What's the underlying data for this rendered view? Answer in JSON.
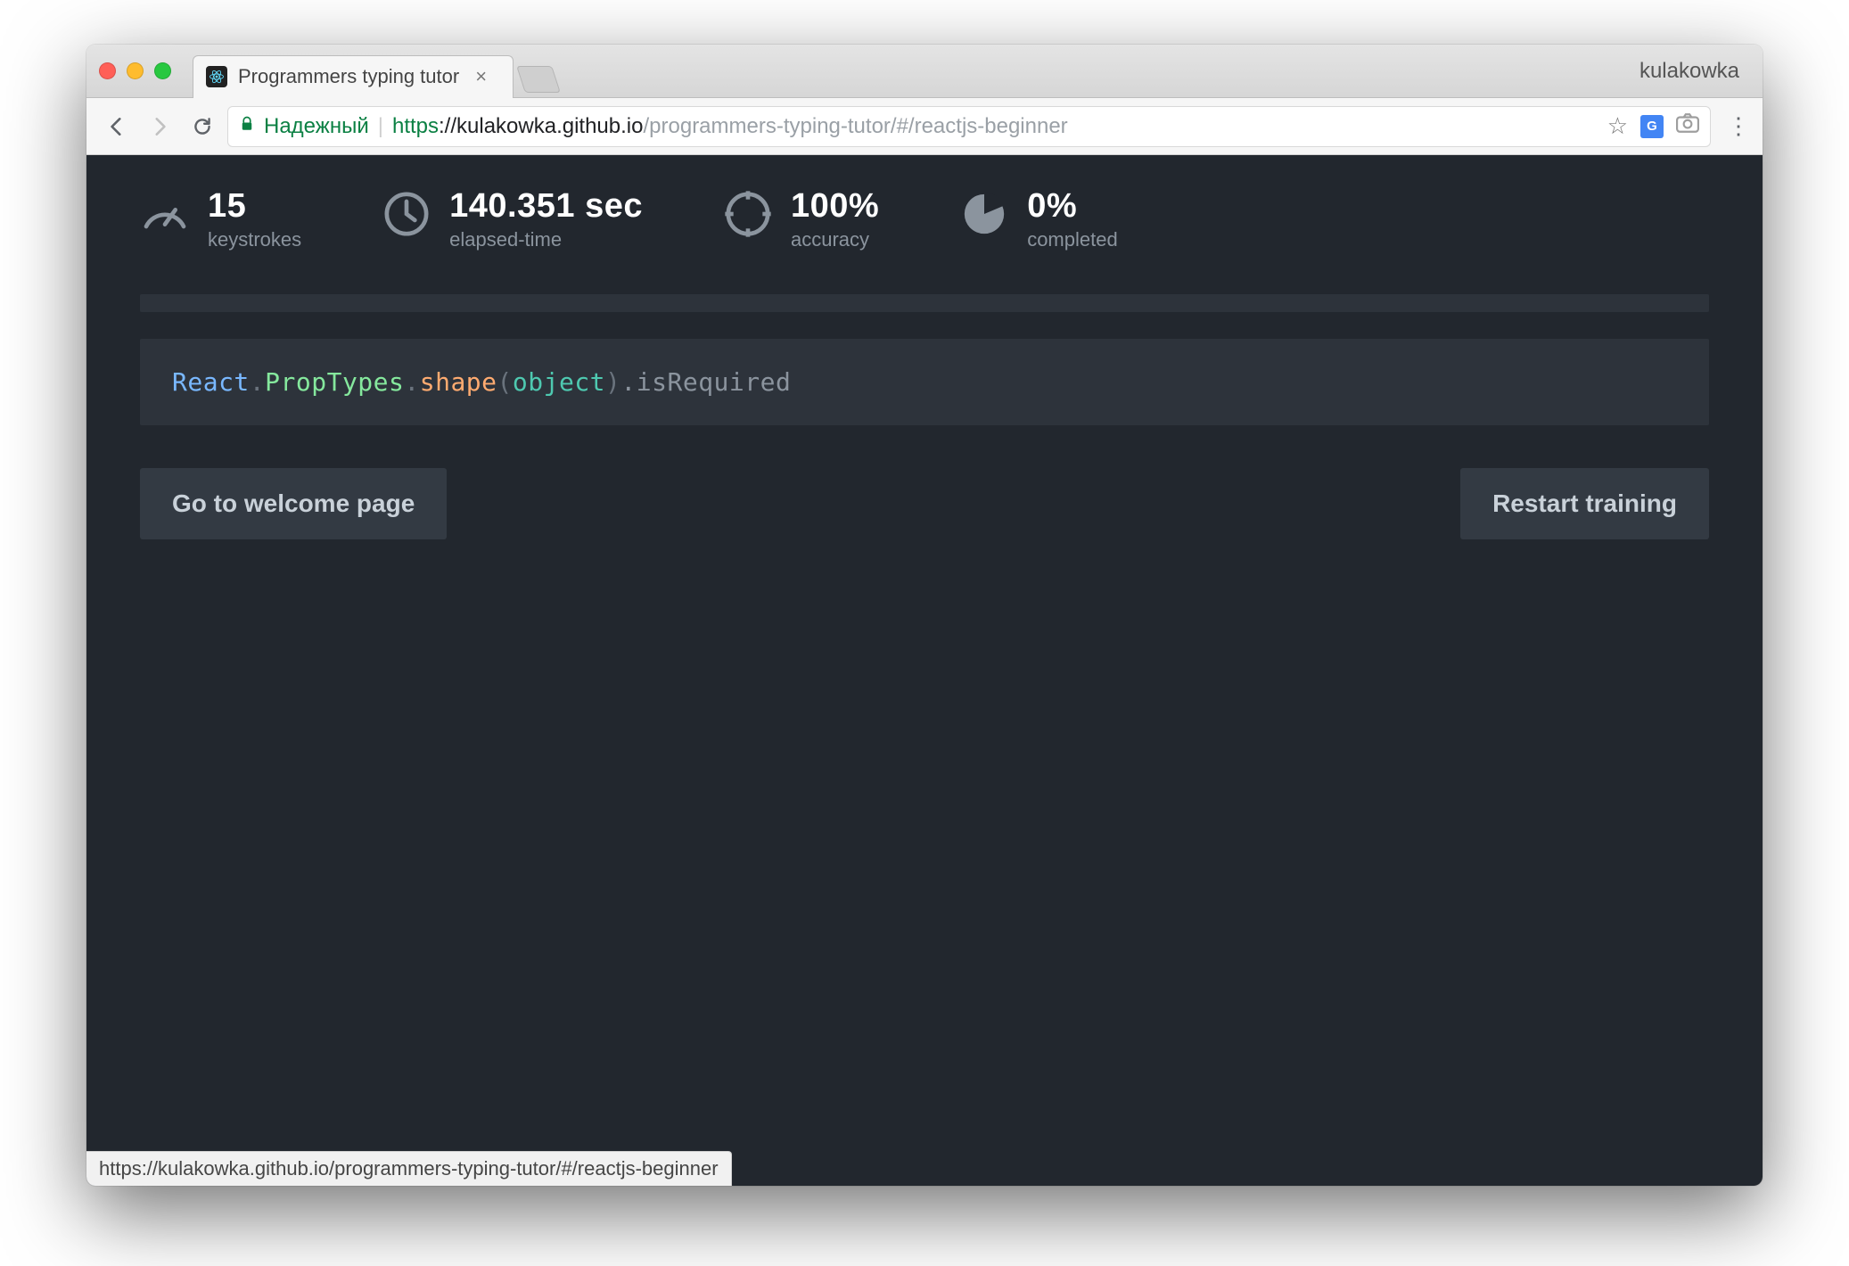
{
  "browser": {
    "tab_title": "Programmers typing tutor",
    "profile_name": "kulakowka",
    "secure_label": "Надежный",
    "url_scheme": "https",
    "url_host": "kulakowka.github.io",
    "url_path": "/programmers-typing-tutor/#/reactjs-beginner",
    "status_bar": "https://kulakowka.github.io/programmers-typing-tutor/#/reactjs-beginner"
  },
  "stats": {
    "keystrokes": {
      "value": "15",
      "label": "keystrokes"
    },
    "elapsed": {
      "value": "140.351 sec",
      "label": "elapsed-time"
    },
    "accuracy": {
      "value": "100%",
      "label": "accuracy"
    },
    "completed": {
      "value": "0%",
      "label": "completed"
    }
  },
  "code": {
    "t1": "React",
    "t2": ".",
    "t3": "PropTypes",
    "t4": ".",
    "t5": "shape",
    "t6": "(",
    "t7": "object",
    "t8": ")",
    "t9": ".",
    "t10": "isRequired"
  },
  "buttons": {
    "welcome": "Go to welcome page",
    "restart": "Restart training"
  },
  "icons": {
    "gt_badge": "G"
  }
}
